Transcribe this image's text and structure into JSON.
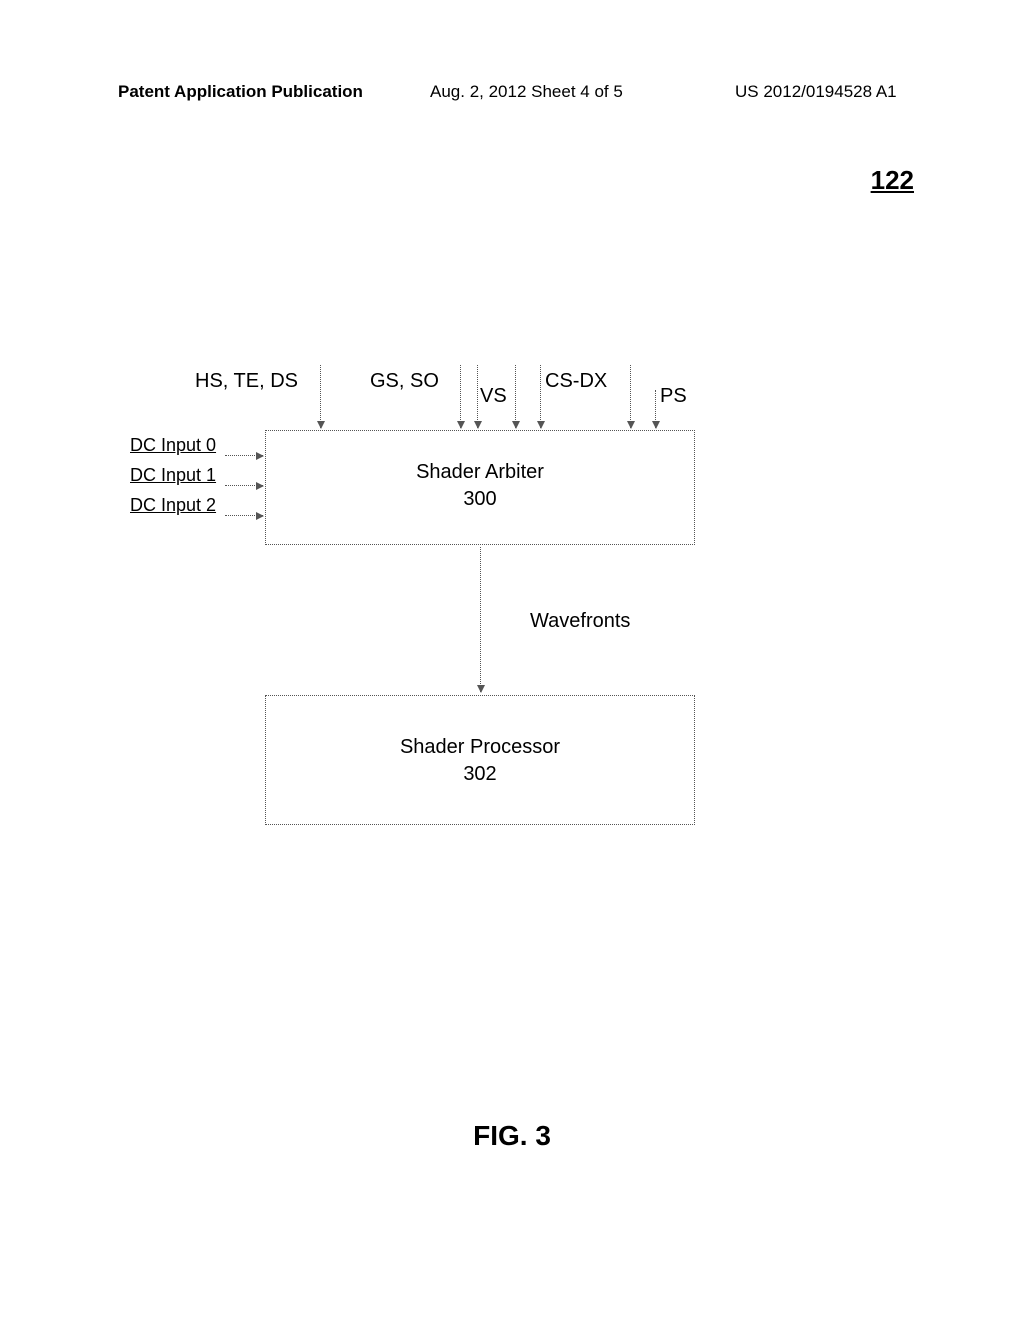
{
  "header": {
    "left": "Patent Application Publication",
    "center": "Aug. 2, 2012  Sheet 4 of 5",
    "right": "US 2012/0194528 A1"
  },
  "ref_number": "122",
  "top_inputs": {
    "hs_te_ds": "HS, TE, DS",
    "gs_so": "GS, SO",
    "vs": "VS",
    "cs_dx": "CS-DX",
    "ps": "PS"
  },
  "dc_inputs": {
    "i0": "DC Input 0",
    "i1": "DC Input 1",
    "i2": "DC Input 2"
  },
  "arbiter": {
    "title": "Shader Arbiter",
    "num": "300"
  },
  "wavefronts": "Wavefronts",
  "processor": {
    "title": "Shader Processor",
    "num": "302"
  },
  "figure_label": "FIG. 3"
}
